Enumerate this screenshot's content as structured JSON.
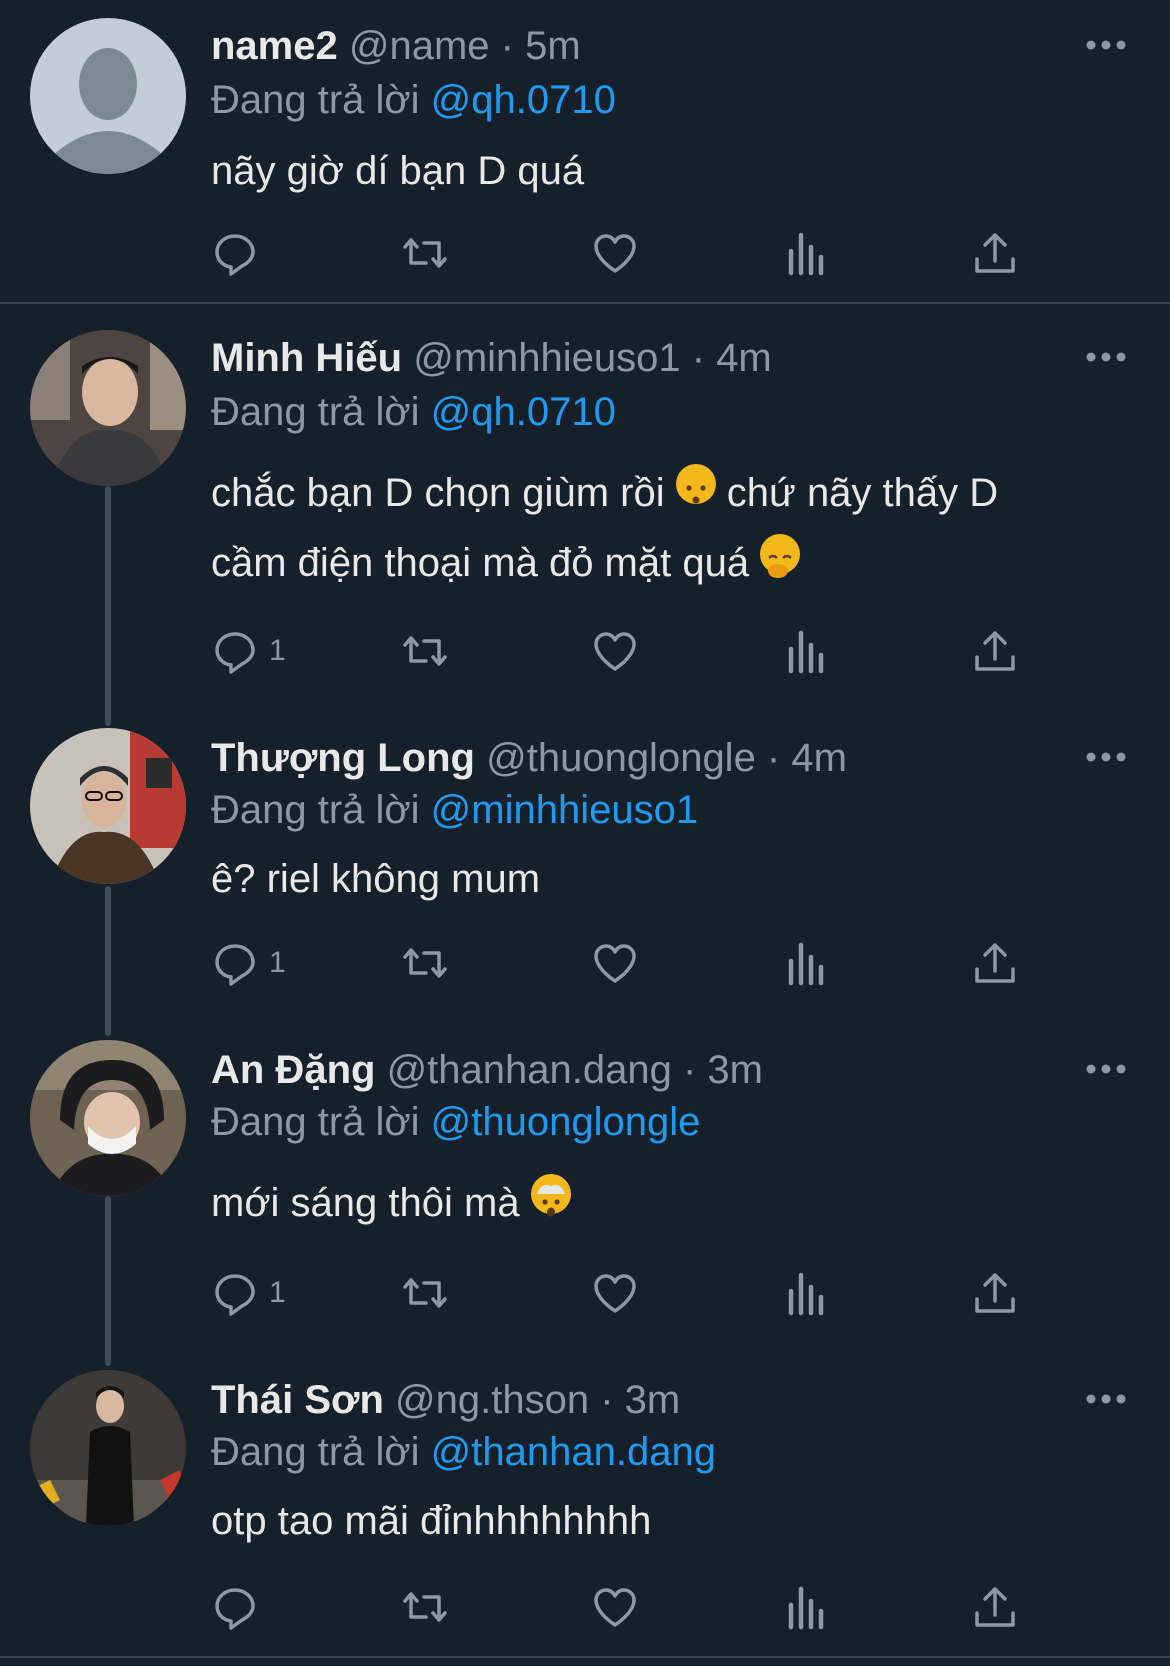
{
  "reply_prefix": "Đang trả lời",
  "colors": {
    "background": "#15202b",
    "text": "#e7e9ea",
    "muted": "#8b98a5",
    "mention": "#1d9bf0"
  },
  "tweets": [
    {
      "name": "name2",
      "meta": "@name · 5m",
      "reply_to": "@qh.0710",
      "text_lines": [
        [
          "nãy giờ dí bạn D quá"
        ]
      ],
      "reply_count": "",
      "avatar": "default-avatar-icon"
    },
    {
      "name": "Minh Hiếu",
      "meta": "@minhhieuso1 · 4m",
      "reply_to": "@qh.0710",
      "text_lines": [
        [
          "chắc bạn D chọn giùm rồi ",
          "kissing-face-emoji",
          "  chứ nãy thấy D"
        ],
        [
          "cầm điện thoại mà đỏ mặt quá ",
          "face-with-hand-over-mouth-emoji"
        ]
      ],
      "reply_count": "1",
      "avatar": "user-photo"
    },
    {
      "name": "Thượng Long",
      "meta": "@thuonglongle · 4m",
      "reply_to": "@minhhieuso1",
      "text_lines": [
        [
          "ê? riel không mum"
        ]
      ],
      "reply_count": "1",
      "avatar": "user-photo"
    },
    {
      "name": "An Đặng",
      "meta": "@thanhan.dang · 3m",
      "reply_to": "@thuonglongle",
      "text_lines": [
        [
          "mới sáng thôi mà ",
          "exploding-head-emoji"
        ]
      ],
      "reply_count": "1",
      "avatar": "user-photo"
    },
    {
      "name": "Thái Sơn",
      "meta": "@ng.thson · 3m",
      "reply_to": "@thanhan.dang",
      "text_lines": [
        [
          "otp tao mãi đỉnhhhhhhhh"
        ]
      ],
      "reply_count": "",
      "avatar": "user-photo"
    }
  ]
}
